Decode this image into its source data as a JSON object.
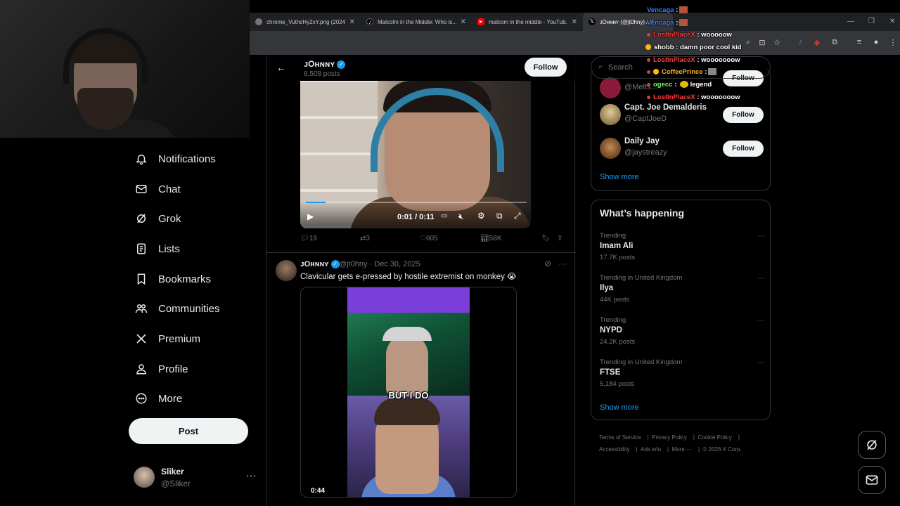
{
  "tabs": [
    {
      "label": "chrome_VuthcHy2xY.png (2024...",
      "icon": "globe-icon"
    },
    {
      "label": "Malcolm in the Middle: Who is...",
      "icon": "tiktok-icon"
    },
    {
      "label": "malcom in the middle - YouTub...",
      "icon": "youtube-icon"
    },
    {
      "label": "ᴊOʜɴɴʏ (@jt0hny) / X",
      "icon": "x-icon"
    }
  ],
  "chat": [
    {
      "name": "Vencaga",
      "sep": ":",
      "msg": "",
      "color": "#3b7bff"
    },
    {
      "name": "LostInPlaceX",
      "sep": ":",
      "msg": "wooooow",
      "color": "#ff3b3b"
    },
    {
      "name": "shobb",
      "sep": ":",
      "msg": "damn poor cool kid",
      "color": "#ffffff"
    },
    {
      "name": "LostInPlaceX",
      "sep": ":",
      "msg": "wooooooow",
      "color": "#ff3b3b"
    },
    {
      "name": "CoffeePrince",
      "sep": ":",
      "msg": "",
      "color": "#ffb02e"
    },
    {
      "name": "ogecc",
      "sep": ":",
      "msg": "legend",
      "color": "#6cff5e"
    },
    {
      "name": "LostInPlaceX",
      "sep": ":",
      "msg": "wooooooow",
      "color": "#ff3b3b"
    }
  ],
  "nav": [
    {
      "label": "Notifications",
      "icon": "bell-icon"
    },
    {
      "label": "Chat",
      "icon": "mail-icon"
    },
    {
      "label": "Grok",
      "icon": "grok-icon"
    },
    {
      "label": "Lists",
      "icon": "list-icon"
    },
    {
      "label": "Bookmarks",
      "icon": "bookmark-icon"
    },
    {
      "label": "Communities",
      "icon": "people-icon"
    },
    {
      "label": "Premium",
      "icon": "x-logo-icon"
    },
    {
      "label": "Profile",
      "icon": "person-icon"
    },
    {
      "label": "More",
      "icon": "more-circle-icon"
    }
  ],
  "post_label": "Post",
  "account": {
    "name": "Sliker",
    "handle": "@Sliker"
  },
  "header": {
    "name": "ᴊOʜɴɴʏ",
    "posts": "8,508 posts",
    "follow": "Follow"
  },
  "video1": {
    "time": "0:01 / 0:11",
    "progress": 0.09
  },
  "tweet1_actions": {
    "replies": "19",
    "reposts": "3",
    "likes": "605",
    "views": "58K"
  },
  "tweet2": {
    "name": "ᴊOʜɴɴʏ",
    "handle": "@jt0hny",
    "date": "Dec 30, 2025",
    "text": "Clavicular gets e-pressed by hostile extremist on monkey 😭",
    "caption": "BUT I DO",
    "duration": "0:44"
  },
  "search_placeholder": "Search",
  "who_to_follow": [
    {
      "name": "",
      "handle": "@Melts...",
      "follow": "Follow"
    },
    {
      "name": "Capt. Joe Demalderis",
      "handle": "@CaptJoeD",
      "follow": "Follow"
    },
    {
      "name": "Daily Jay",
      "handle": "@jaystreazy",
      "follow": "Follow"
    }
  ],
  "show_more": "Show more",
  "happening_title": "What’s happening",
  "trends": [
    {
      "context": "Trending",
      "name": "Imam Ali",
      "count": "17.7K posts"
    },
    {
      "context": "Trending in United Kingdom",
      "name": "Ilya",
      "count": "44K posts"
    },
    {
      "context": "Trending",
      "name": "NYPD",
      "count": "24.2K posts"
    },
    {
      "context": "Trending in United Kingdom",
      "name": "FTSE",
      "count": "5,184 posts"
    }
  ],
  "footer": [
    "Terms of Service",
    "Privacy Policy",
    "Cookie Policy",
    "Accessibility",
    "Ads info",
    "More ···",
    "© 2026 X Corp."
  ]
}
